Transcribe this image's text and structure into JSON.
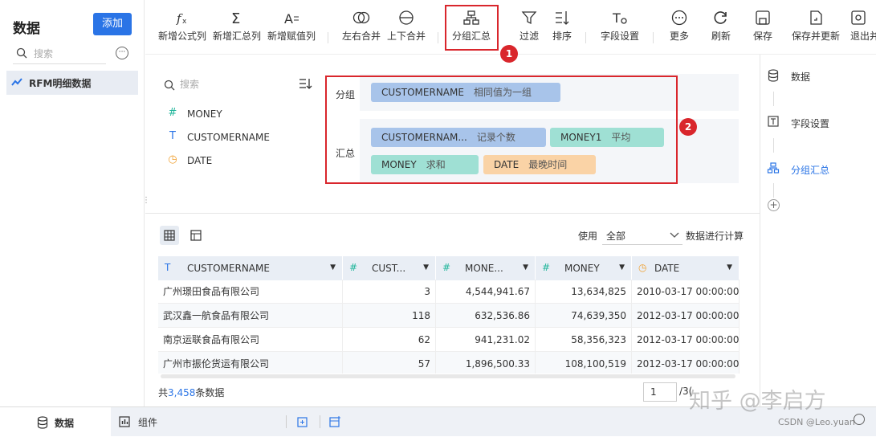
{
  "sidebar": {
    "title": "数据",
    "add_label": "添加",
    "search_placeholder": "搜索",
    "more_label": "···",
    "dataset": "RFM明细数据"
  },
  "toolbar": {
    "items": [
      {
        "label": "新增公式列",
        "icon": "fx-icon"
      },
      {
        "label": "新增汇总列",
        "icon": "sigma-icon"
      },
      {
        "label": "新增赋值列",
        "icon": "assign-icon"
      },
      {
        "label": "左右合并",
        "icon": "merge-horizontal-icon"
      },
      {
        "label": "上下合并",
        "icon": "merge-vertical-icon"
      },
      {
        "label": "分组汇总",
        "icon": "group-summary-icon"
      },
      {
        "label": "过滤",
        "icon": "filter-icon"
      },
      {
        "label": "排序",
        "icon": "sort-icon"
      },
      {
        "label": "字段设置",
        "icon": "field-settings-icon"
      },
      {
        "label": "更多",
        "icon": "more-icon"
      },
      {
        "label": "刷新",
        "icon": "refresh-icon"
      },
      {
        "label": "保存",
        "icon": "save-icon"
      },
      {
        "label": "保存并更新",
        "icon": "save-update-icon"
      },
      {
        "label": "退出并",
        "icon": "exit-icon"
      }
    ]
  },
  "badges": {
    "one": "1",
    "two": "2"
  },
  "fields_panel": {
    "search_placeholder": "搜索",
    "fields": [
      {
        "type": "number",
        "glyph": "#",
        "name": "MONEY"
      },
      {
        "type": "text",
        "glyph": "T",
        "name": "CUSTOMERNAME"
      },
      {
        "type": "date",
        "glyph": "◷",
        "name": "DATE"
      }
    ]
  },
  "config": {
    "group_label": "分组",
    "summary_label": "汇总",
    "group_tags": [
      {
        "field": "CUSTOMERNAME",
        "method": "相同值为一组",
        "color": "blue"
      }
    ],
    "summary_tags": [
      {
        "field": "CUSTOMERNAM...",
        "method": "记录个数",
        "color": "blue"
      },
      {
        "field": "MONEY1",
        "method": "平均",
        "color": "green"
      },
      {
        "field": "MONEY",
        "method": "求和",
        "color": "green"
      },
      {
        "field": "DATE",
        "method": "最晚时间",
        "color": "orange"
      }
    ]
  },
  "steps": [
    {
      "label": "数据",
      "icon": "database-icon"
    },
    {
      "label": "字段设置",
      "icon": "field-settings-icon"
    },
    {
      "label": "分组汇总",
      "icon": "group-summary-icon"
    }
  ],
  "preview": {
    "calc_label": "使用",
    "calc_value": "全部",
    "calc_suffix": "数据进行计算",
    "columns": [
      {
        "type": "text",
        "glyph": "T",
        "name": "CUSTOMERNAME",
        "arrow": "▼"
      },
      {
        "type": "number",
        "glyph": "#",
        "name": "CUST...",
        "arrow": "▼"
      },
      {
        "type": "number",
        "glyph": "#",
        "name": "MONE...",
        "arrow": "▼"
      },
      {
        "type": "number",
        "glyph": "#",
        "name": "MONEY",
        "arrow": "▼"
      },
      {
        "type": "date",
        "glyph": "◷",
        "name": "DATE",
        "arrow": "▼"
      }
    ],
    "rows": [
      [
        "广州璟田食品有限公司",
        "3",
        "4,544,941.67",
        "13,634,825",
        "2010-03-17 00:00:00"
      ],
      [
        "武汉鑫一航食品有限公司",
        "118",
        "632,536.86",
        "74,639,350",
        "2012-03-17 00:00:00"
      ],
      [
        "南京运联食品有限公司",
        "62",
        "941,231.02",
        "58,356,323",
        "2012-03-17 00:00:00"
      ],
      [
        "广州市振伦货运有限公司",
        "57",
        "1,896,500.33",
        "108,100,519",
        "2012-03-17 00:00:00"
      ]
    ],
    "total_prefix": "共",
    "total_count": "3,458",
    "total_suffix": "条数据",
    "page_current": "1",
    "page_total": "/3("
  },
  "watermark": {
    "main": "知乎 @李启方",
    "sub": "CSDN @Leo.yuan"
  },
  "bottom_tabs": {
    "data": "数据",
    "component": "组件"
  }
}
